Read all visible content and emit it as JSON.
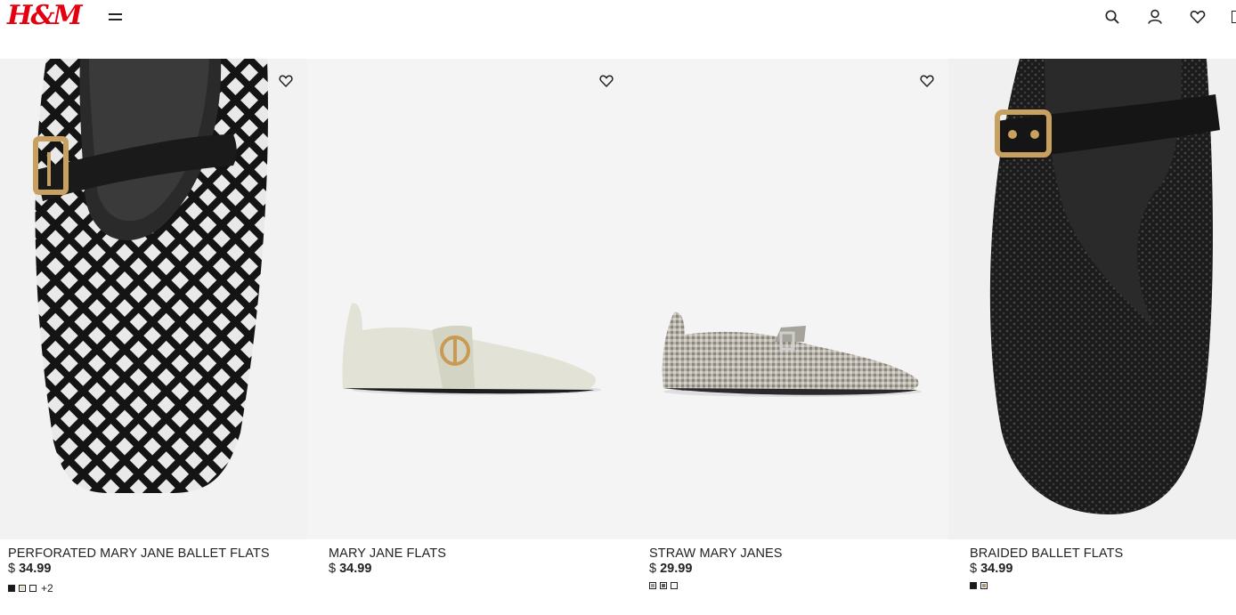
{
  "header": {
    "logo": "H&M",
    "icons": [
      "menu-icon",
      "search-icon",
      "account-icon",
      "heart-icon",
      "bag-icon"
    ]
  },
  "products": [
    {
      "name": "PERFORATED MARY JANE BALLET FLATS",
      "currency": "$",
      "price": "34.99",
      "more_colors": "+2",
      "swatches": [
        "#1a1a1a",
        "#e8dcc0",
        "#ffffff"
      ]
    },
    {
      "name": "MARY JANE FLATS",
      "currency": "$",
      "price": "34.99",
      "more_colors": "",
      "swatches": []
    },
    {
      "name": "STRAW MARY JANES",
      "currency": "$",
      "price": "29.99",
      "more_colors": "",
      "swatches": [
        "#9a9a9a",
        "#5a5a5a",
        "#f4f4f4"
      ]
    },
    {
      "name": "BRAIDED BALLET FLATS",
      "currency": "$",
      "price": "34.99",
      "more_colors": "",
      "swatches": [
        "#1a1a1a",
        "#a89870"
      ]
    }
  ],
  "colors": {
    "brand": "#e50010",
    "image_bg": "#f4f4f4",
    "text": "#222222"
  }
}
